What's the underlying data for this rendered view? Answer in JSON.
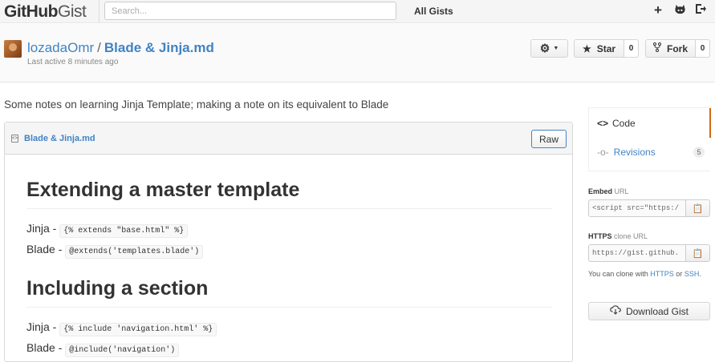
{
  "topbar": {
    "logo_bold": "GitHub",
    "logo_light": "Gist",
    "search_placeholder": "Search...",
    "all_gists": "All Gists",
    "icons": [
      "plus-icon",
      "octocat-icon",
      "sign-out-icon"
    ]
  },
  "gist": {
    "owner": "lozadaOmr",
    "separator": "/",
    "name": "Blade & Jinja.md",
    "activity": "Last active 8 minutes ago",
    "star_label": "Star",
    "star_count": "0",
    "fork_label": "Fork",
    "fork_count": "0"
  },
  "description": "Some notes on learning Jinja Template; making a note on its equivalent to Blade",
  "file": {
    "name": "Blade & Jinja.md",
    "raw_label": "Raw",
    "sections": [
      {
        "heading": "Extending a master template",
        "jinja_label": "Jinja -",
        "jinja_code": "{% extends \"base.html\" %}",
        "blade_label": "Blade -",
        "blade_code": "@extends('templates.blade')"
      },
      {
        "heading": "Including a section",
        "jinja_label": "Jinja -",
        "jinja_code": "{% include 'navigation.html' %}",
        "blade_label": "Blade -",
        "blade_code": "@include('navigation')"
      }
    ]
  },
  "sidebar": {
    "code_label": "Code",
    "revisions_label": "Revisions",
    "revisions_count": "5",
    "embed_label_bold": "Embed",
    "embed_label_light": "URL",
    "embed_value": "<script src=\"https:/",
    "https_label_bold": "HTTPS",
    "https_label_light": "clone URL",
    "https_value": "https://gist.github.",
    "clone_help_prefix": "You can clone with",
    "clone_help_https": "HTTPS",
    "clone_help_or": "or",
    "clone_help_ssh": "SSH",
    "clone_help_suffix": ".",
    "download_label": "Download Gist"
  },
  "colors": {
    "link": "#4183c4",
    "active_tab": "#d26911"
  }
}
